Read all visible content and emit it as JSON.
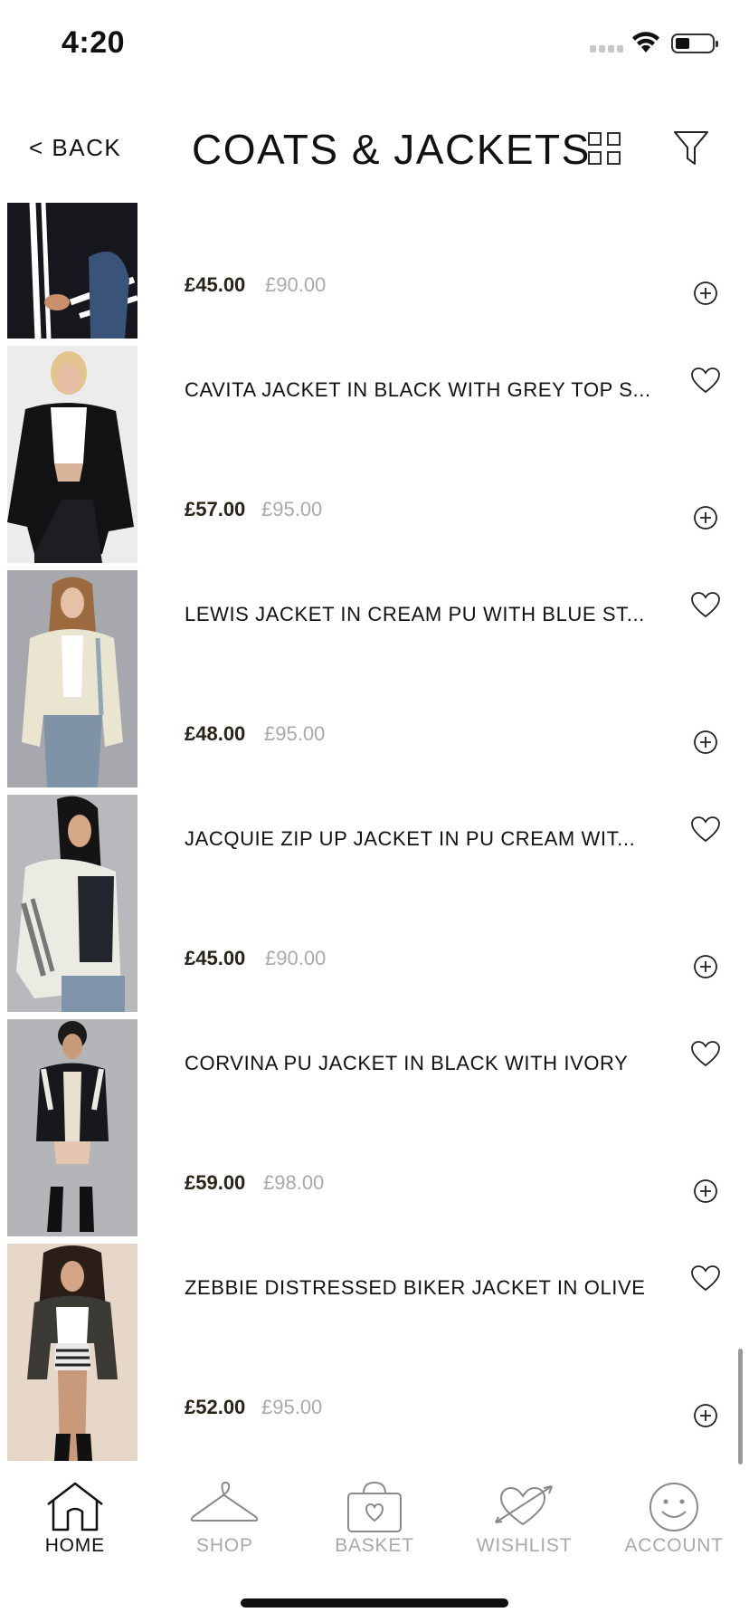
{
  "status_bar": {
    "time": "4:20"
  },
  "header": {
    "back_label": "< BACK",
    "title": "COATS & JACKETS"
  },
  "products": [
    {
      "name": "",
      "price": "£45.00",
      "original_price": "£90.00",
      "image": "black-track-jacket-white-stripes"
    },
    {
      "name": "CAVITA JACKET IN BLACK WITH GREY TOP S...",
      "price": "£57.00",
      "original_price": "£95.00",
      "image": "black-leather-bomber"
    },
    {
      "name": "LEWIS JACKET IN CREAM PU WITH BLUE ST...",
      "price": "£48.00",
      "original_price": "£95.00",
      "image": "cream-jacket-blue-stripe"
    },
    {
      "name": "JACQUIE ZIP UP JACKET IN PU CREAM WIT...",
      "price": "£45.00",
      "original_price": "£90.00",
      "image": "cream-zip-jacket-grey-stripes"
    },
    {
      "name": "CORVINA PU JACKET IN BLACK WITH IVORY",
      "price": "£59.00",
      "original_price": "£98.00",
      "image": "black-pu-jacket-ivory"
    },
    {
      "name": "ZEBBIE DISTRESSED BIKER JACKET IN OLIVE",
      "price": "£52.00",
      "original_price": "£95.00",
      "image": "olive-biker-jacket"
    }
  ],
  "tab_bar": {
    "tabs": [
      {
        "label": "HOME",
        "icon": "home-icon",
        "active": true
      },
      {
        "label": "SHOP",
        "icon": "hanger-icon",
        "active": false
      },
      {
        "label": "BASKET",
        "icon": "bag-icon",
        "active": false
      },
      {
        "label": "WISHLIST",
        "icon": "heart-arrow-icon",
        "active": false
      },
      {
        "label": "ACCOUNT",
        "icon": "smiley-icon",
        "active": false
      }
    ]
  },
  "colors": {
    "price": "#2a2316",
    "original_price": "#a9a9a9",
    "inactive_tab": "#a9a9a9",
    "active_tab": "#111111"
  }
}
